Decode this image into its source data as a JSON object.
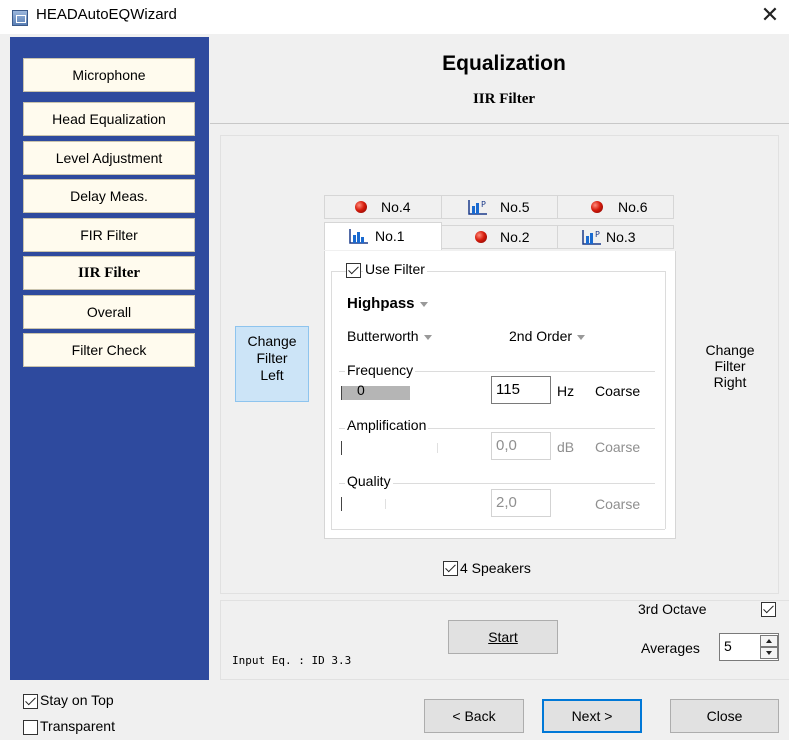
{
  "window": {
    "title": "HEADAutoEQWizard"
  },
  "sidebar": {
    "items": [
      {
        "label": "Microphone",
        "active": false
      },
      {
        "label": "Head Equalization",
        "active": false
      },
      {
        "label": "Level Adjustment",
        "active": false
      },
      {
        "label": "Delay  Meas.",
        "active": false
      },
      {
        "label": "FIR Filter",
        "active": false
      },
      {
        "label": "IIR Filter",
        "active": true
      },
      {
        "label": "Overall",
        "active": false
      },
      {
        "label": "Filter Check",
        "active": false
      }
    ]
  },
  "header": {
    "title": "Equalization",
    "subtitle": "IIR Filter"
  },
  "change_filter": {
    "left": [
      "Change",
      "Filter",
      "Left"
    ],
    "right": [
      "Change",
      "Filter",
      "Right"
    ]
  },
  "tabs": {
    "back_row": [
      {
        "label": "No.4",
        "icon": "red-dot-icon"
      },
      {
        "label": "No.5",
        "icon": "filter-chart-icon"
      },
      {
        "label": "No.6",
        "icon": "red-dot-icon"
      }
    ],
    "front_row": [
      {
        "label": "No.1",
        "icon": "filter-chart-icon",
        "active": true
      },
      {
        "label": "No.2",
        "icon": "red-dot-icon"
      },
      {
        "label": "No.3",
        "icon": "filter-chart-icon"
      }
    ]
  },
  "filter": {
    "use_filter_label": "Use Filter",
    "use_filter_checked": true,
    "type": "Highpass",
    "characteristic": "Butterworth",
    "order": "2nd Order",
    "frequency": {
      "label": "Frequency",
      "slider_text": "0",
      "value": "115",
      "unit": "Hz",
      "mode": "Coarse",
      "level": 0.45
    },
    "amplification": {
      "label": "Amplification",
      "value": "0,0",
      "unit": "dB",
      "mode": "Coarse"
    },
    "quality": {
      "label": "Quality",
      "value": "2,0",
      "unit": "",
      "mode": "Coarse"
    }
  },
  "speakers": {
    "label": "4 Speakers",
    "checked": true
  },
  "start_label": "Start",
  "input_eq": "Input Eq. : ID 3.3",
  "third_octave": {
    "label": "3rd Octave",
    "checked": true
  },
  "averages": {
    "label": "Averages",
    "value": "5"
  },
  "options": {
    "stay_on_top": {
      "label": "Stay on Top",
      "checked": true
    },
    "transparent": {
      "label": "Transparent",
      "checked": false
    }
  },
  "footer": {
    "back": "< Back",
    "next": "Next >",
    "close": "Close"
  },
  "colors": {
    "sidebar": "#2e4a9e",
    "active_button_border": "#0078d7",
    "filter_dot": "#d61c0c"
  }
}
